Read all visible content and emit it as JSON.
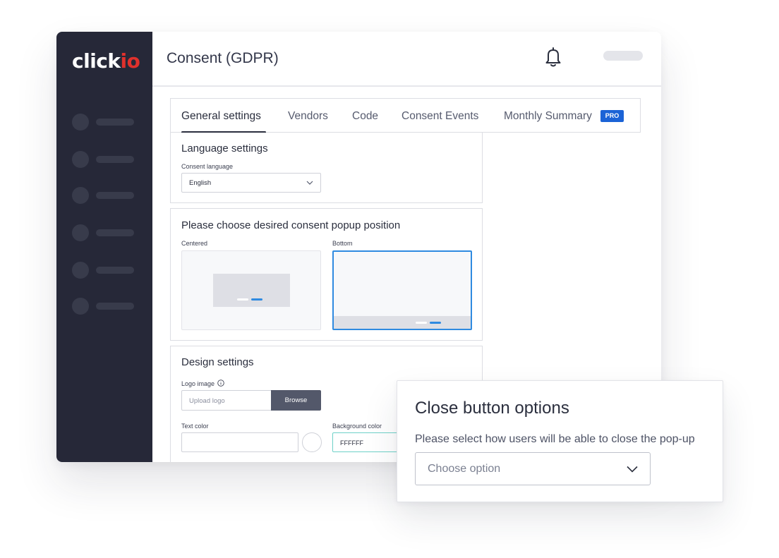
{
  "app": {
    "logo_main": "click",
    "logo_accent": "io",
    "page_title": "Consent (GDPR)"
  },
  "tabs": [
    {
      "label": "General settings",
      "active": true
    },
    {
      "label": "Vendors"
    },
    {
      "label": "Code"
    },
    {
      "label": "Consent Events"
    },
    {
      "label": "Monthly Summary",
      "badge": "PRO"
    }
  ],
  "language_settings": {
    "title": "Language settings",
    "field_label": "Consent language",
    "selected": "English"
  },
  "popup_position": {
    "title": "Please choose desired consent popup position",
    "options": [
      {
        "label": "Centered"
      },
      {
        "label": "Bottom",
        "selected": true
      }
    ]
  },
  "design_settings": {
    "title": "Design settings",
    "logo_label": "Logo image",
    "logo_placeholder": "Upload logo",
    "browse_label": "Browse",
    "text_color_label": "Text color",
    "background_color_label": "Background color",
    "background_color_value": "FFFFFF"
  },
  "close_button_options": {
    "title": "Close button options",
    "description": "Please select how users will be able to close the pop-up",
    "placeholder": "Choose option"
  },
  "colors": {
    "sidebar": "#262838",
    "accent": "#e0312c",
    "primary_blue": "#2f8ae0",
    "pro_badge": "#1b63d6"
  }
}
